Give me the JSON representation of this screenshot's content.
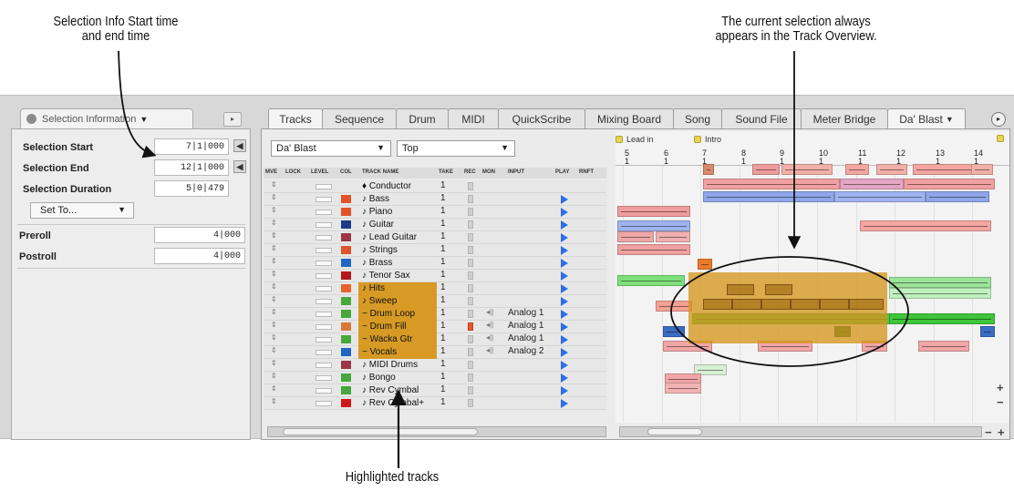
{
  "annotations": {
    "selection_info": "Selection Info Start time\nand end time",
    "track_overview": "The current selection always\nappears in the Track Overview.",
    "highlighted_tracks": "Highlighted tracks"
  },
  "left_panel": {
    "tab_title": "Selection Information",
    "selection_start_label": "Selection Start",
    "selection_start_value": "7|1|000",
    "selection_end_label": "Selection End",
    "selection_end_value": "12|1|000",
    "selection_duration_label": "Selection Duration",
    "selection_duration_value": "5|0|479",
    "set_to_label": "Set To...",
    "preroll_label": "Preroll",
    "preroll_value": "4|000",
    "postroll_label": "Postroll",
    "postroll_value": "4|000"
  },
  "tabs": [
    "Tracks",
    "Sequence",
    "Drum",
    "MIDI",
    "QuickScribe",
    "Mixing Board",
    "Song",
    "Sound File",
    "Meter Bridge",
    "Da' Blast"
  ],
  "track_list": {
    "sequence_select": "Da' Blast",
    "view_select": "Top",
    "headers": {
      "move": "MVE",
      "lock": "LOCK",
      "level": "LEVEL",
      "color": "COL",
      "name": "TRACK NAME",
      "take": "TAKE",
      "rec": "REC",
      "mon": "MON",
      "input": "INPUT",
      "play": "PLAY",
      "rnft": "RNFT"
    },
    "rows": [
      {
        "name": "Conductor",
        "take": "1",
        "color": "",
        "input": "",
        "hl": false,
        "rec": false,
        "mon": false,
        "play": false
      },
      {
        "name": "Bass",
        "take": "1",
        "color": "#e2522a",
        "input": "",
        "hl": false,
        "rec": false,
        "mon": false,
        "play": true
      },
      {
        "name": "Piano",
        "take": "1",
        "color": "#e2522a",
        "input": "",
        "hl": false,
        "rec": false,
        "mon": false,
        "play": true
      },
      {
        "name": "Guitar",
        "take": "1",
        "color": "#1c3a8a",
        "input": "",
        "hl": false,
        "rec": false,
        "mon": false,
        "play": true
      },
      {
        "name": "Lead Guitar",
        "take": "1",
        "color": "#9a3648",
        "input": "",
        "hl": false,
        "rec": false,
        "mon": false,
        "play": true
      },
      {
        "name": "Strings",
        "take": "1",
        "color": "#e2522a",
        "input": "",
        "hl": false,
        "rec": false,
        "mon": false,
        "play": true
      },
      {
        "name": "Brass",
        "take": "1",
        "color": "#1f66c4",
        "input": "",
        "hl": false,
        "rec": false,
        "mon": false,
        "play": true
      },
      {
        "name": "Tenor Sax",
        "take": "1",
        "color": "#b3161c",
        "input": "",
        "hl": false,
        "rec": false,
        "mon": false,
        "play": true
      },
      {
        "name": "Hits",
        "take": "1",
        "color": "#e8622d",
        "input": "",
        "hl": true,
        "rec": false,
        "mon": false,
        "play": true
      },
      {
        "name": "Sweep",
        "take": "1",
        "color": "#46a83a",
        "input": "",
        "hl": true,
        "rec": false,
        "mon": false,
        "play": true
      },
      {
        "name": "Drum Loop",
        "take": "1",
        "color": "#46a83a",
        "input": "Analog 1",
        "hl": true,
        "rec": false,
        "mon": true,
        "play": true
      },
      {
        "name": "Drum Fill",
        "take": "1",
        "color": "#d87a35",
        "input": "Analog 1",
        "hl": true,
        "rec": true,
        "mon": true,
        "play": true
      },
      {
        "name": "Wacka Gtr",
        "take": "1",
        "color": "#46a83a",
        "input": "Analog 1",
        "hl": true,
        "rec": false,
        "mon": true,
        "play": true
      },
      {
        "name": "Vocals",
        "take": "1",
        "color": "#1f66c4",
        "input": "Analog 2",
        "hl": true,
        "rec": false,
        "mon": true,
        "play": true
      },
      {
        "name": "MIDI Drums",
        "take": "1",
        "color": "#9a3648",
        "input": "",
        "hl": false,
        "rec": false,
        "mon": false,
        "play": true
      },
      {
        "name": "Bongo",
        "take": "1",
        "color": "#46a83a",
        "input": "",
        "hl": false,
        "rec": false,
        "mon": false,
        "play": true
      },
      {
        "name": "Rev Cymbal",
        "take": "1",
        "color": "#46a83a",
        "input": "",
        "hl": false,
        "rec": false,
        "mon": false,
        "play": true
      },
      {
        "name": "Rev Cymbal+",
        "take": "1",
        "color": "#d2141b",
        "input": "",
        "hl": false,
        "rec": false,
        "mon": false,
        "play": true
      }
    ]
  },
  "overview": {
    "markers": [
      "Lead in",
      "Intro"
    ],
    "measures": [
      "5",
      "6",
      "7",
      "8",
      "9",
      "10",
      "11",
      "12",
      "13",
      "14"
    ],
    "beat": "1"
  },
  "colors": {
    "selection": "#d4961e",
    "pink_clip": "#f0a0a0",
    "blue_clip": "#8ea6e8",
    "green_clip": "#7ee07a"
  }
}
